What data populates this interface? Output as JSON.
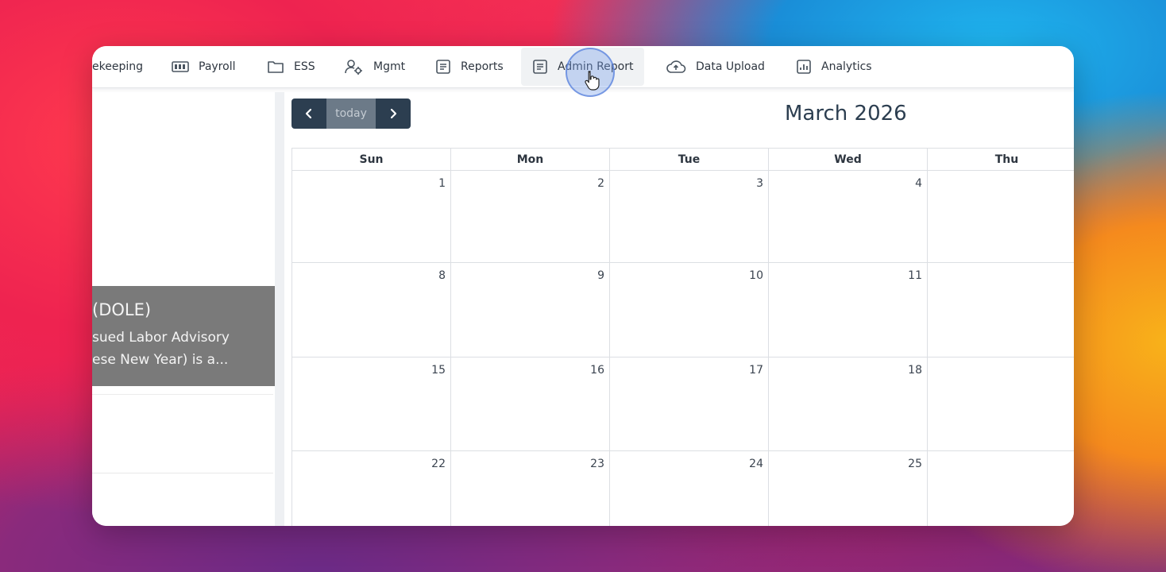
{
  "nav": {
    "items": [
      {
        "label": "ekeeping",
        "icon": "timekeeping-icon"
      },
      {
        "label": "Payroll",
        "icon": "payroll-icon"
      },
      {
        "label": "ESS",
        "icon": "folder-icon"
      },
      {
        "label": "Mgmt",
        "icon": "user-gear-icon"
      },
      {
        "label": "Reports",
        "icon": "document-icon"
      },
      {
        "label": "Admin Report",
        "icon": "document-icon"
      },
      {
        "label": "Data Upload",
        "icon": "cloud-upload-icon"
      },
      {
        "label": "Analytics",
        "icon": "bar-chart-icon"
      }
    ],
    "active": "Admin Report"
  },
  "announcement": {
    "title": "(DOLE)",
    "line1": "sued Labor Advisory",
    "line2": "ese New Year) is a..."
  },
  "calendar": {
    "title": "March 2026",
    "today_label": "today",
    "prev_icon": "chevron-left-icon",
    "next_icon": "chevron-right-icon",
    "days": [
      "Sun",
      "Mon",
      "Tue",
      "Wed",
      "Thu"
    ],
    "weeks": [
      [
        "1",
        "2",
        "3",
        "4",
        ""
      ],
      [
        "8",
        "9",
        "10",
        "11",
        ""
      ],
      [
        "15",
        "16",
        "17",
        "18",
        ""
      ],
      [
        "22",
        "23",
        "24",
        "25",
        ""
      ]
    ]
  },
  "colors": {
    "nav_button": "#2c3e50",
    "today_button": "#6c7a88",
    "announcement_bg": "#7a7a7a"
  }
}
